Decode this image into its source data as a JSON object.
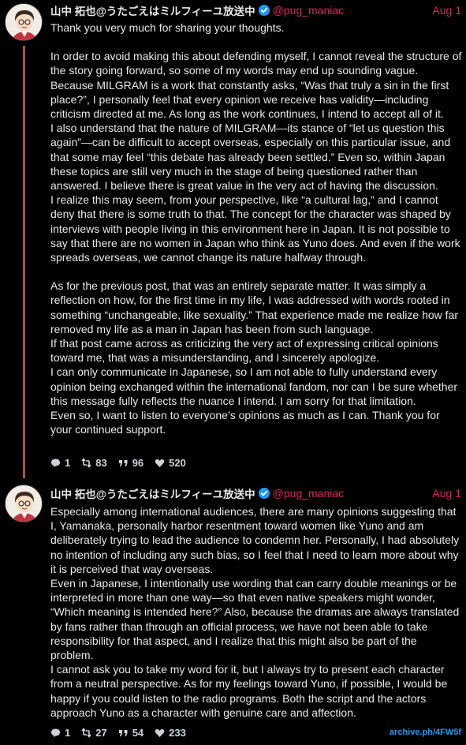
{
  "posts": [
    {
      "author": "山中 拓也@うたごえはミルフィーユ放送中",
      "handle": "@pug_maniac",
      "date": "Aug 1",
      "paragraphs": [
        "Thank you very much for sharing your thoughts.",
        "",
        "In order to avoid making this about defending myself, I cannot reveal the structure of the story going forward, so some of my words may end up sounding vague.",
        "Because MILGRAM is a work that constantly asks, “Was that truly a sin in the first place?”, I personally feel that every opinion we receive has validity—including criticism directed at me. As long as the work continues, I intend to accept all of it.",
        "I also understand that the nature of MILGRAM—its stance of “let us question this again”—can be difficult to accept overseas, especially on this particular issue, and that some may feel “this debate has already been settled.” Even so, within Japan these topics are still very much in the stage of being questioned rather than answered. I believe there is great value in the very act of having the discussion.",
        "I realize this may seem, from your perspective, like “a cultural lag,” and I cannot deny that there is some truth to that. The concept for the character was shaped by interviews with people living in this environment here in Japan. It is not possible to say that there are no women in Japan who think as Yuno does. And even if the work spreads overseas, we cannot change its nature halfway through.",
        "",
        "As for the previous post, that was an entirely separate matter. It was simply a reflection on how, for the first time in my life, I was addressed with words rooted in something “unchangeable, like sexuality.” That experience made me realize how far removed my life as a man in Japan has been from such language.",
        "If that post came across as criticizing the very act of expressing critical opinions toward me, that was a misunderstanding, and I sincerely apologize.",
        "I can only communicate in Japanese, so I am not able to fully understand every opinion being exchanged within the international fandom, nor can I be sure whether this message fully reflects the nuance I intend. I am sorry for that limitation.",
        "Even so, I want to listen to everyone’s opinions as much as I can. Thank you for your continued support."
      ],
      "stats": {
        "replies": "1",
        "reposts": "83",
        "quotes": "96",
        "likes": "520"
      }
    },
    {
      "author": "山中 拓也@うたごえはミルフィーユ放送中",
      "handle": "@pug_maniac",
      "date": "Aug 1",
      "paragraphs": [
        "Especially among international audiences, there are many opinions suggesting that I, Yamanaka, personally harbor resentment toward women like Yuno and am deliberately trying to lead the audience to condemn her. Personally, I had absolutely no intention of including any such bias, so I feel that I need to learn more about why it is perceived that way overseas.",
        "Even in Japanese, I intentionally use wording that can carry double meanings or be interpreted in more than one way—so that even native speakers might wonder, “Which meaning is intended here?” Also, because the dramas are always translated by fans rather than through an official process, we have not been able to take responsibility for that aspect, and I realize that this might also be part of the problem.",
        "I cannot ask you to take my word for it, but I always try to present each character from a neutral perspective. As for my feelings toward Yuno, if possible, I would be happy if you could listen to the radio programs. Both the script and the actors approach Yuno as a character with genuine care and affection."
      ],
      "stats": {
        "replies": "1",
        "reposts": "27",
        "quotes": "54",
        "likes": "233"
      }
    }
  ],
  "archive_link": "archive.ph/4FW5f",
  "colors": {
    "accent": "#e0245e",
    "thread": "#b5504d",
    "text": "#e7e9ea",
    "link": "#1d9bf0"
  },
  "icons": [
    "avatar",
    "verified-badge-icon",
    "reply-icon",
    "repost-icon",
    "quote-icon",
    "like-icon"
  ]
}
